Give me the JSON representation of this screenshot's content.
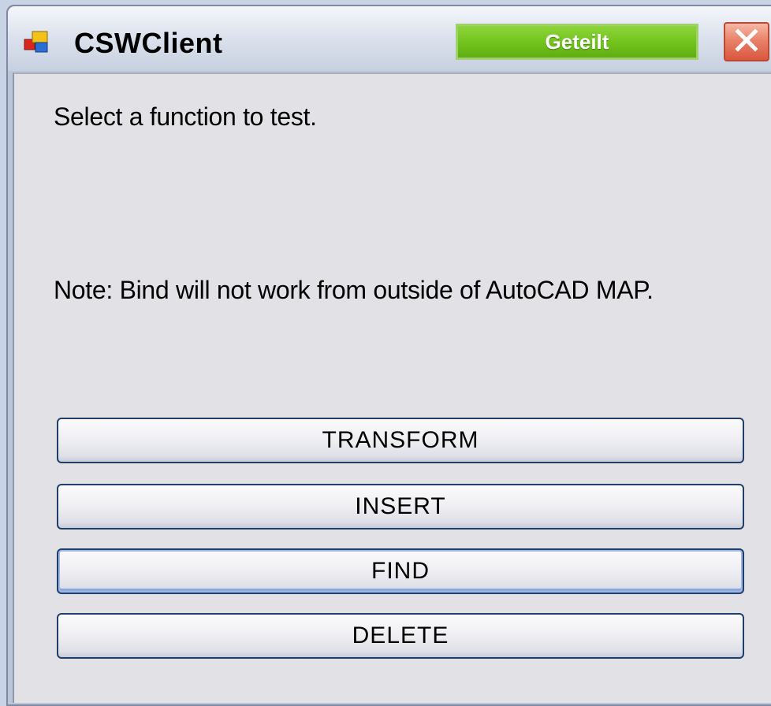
{
  "window": {
    "title": "CSWClient",
    "badge_label": "Geteilt",
    "icon": "app-window-icon",
    "close_icon": "close-icon"
  },
  "content": {
    "instruction": "Select a function to test.",
    "note": "Note: Bind will not work from outside of AutoCAD MAP."
  },
  "buttons": {
    "transform": "TRANSFORM",
    "insert": "INSERT",
    "find": "FIND",
    "delete": "DELETE"
  },
  "colors": {
    "badge": "#72c21c",
    "close": "#d9573e",
    "button_border": "#1f3f6a",
    "client_background": "#e2e1e6"
  }
}
